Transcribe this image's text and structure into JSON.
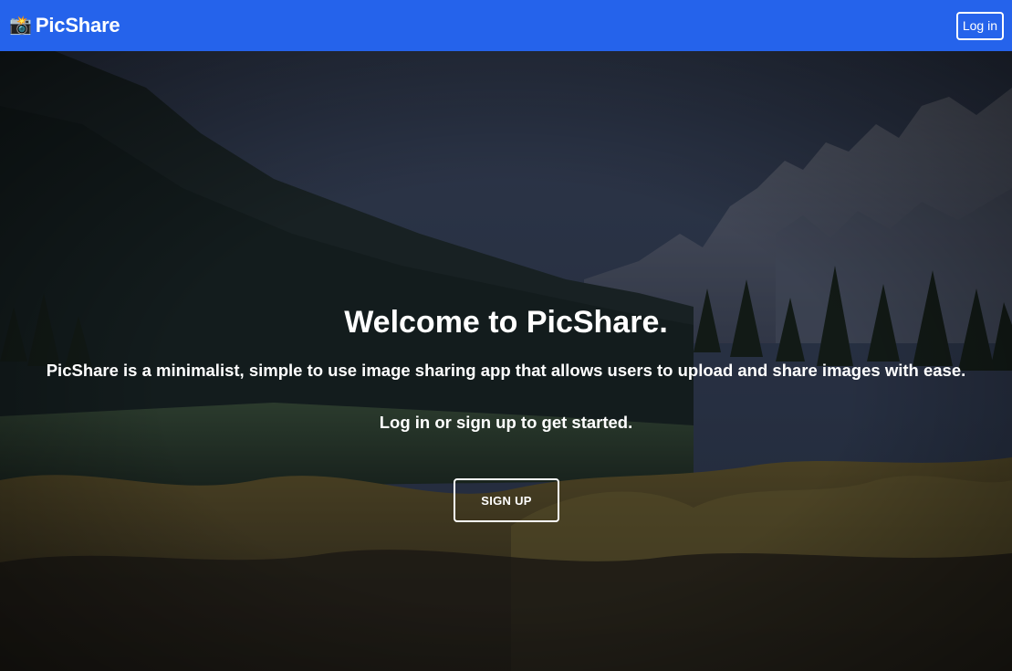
{
  "navbar": {
    "brand_icon": "📸",
    "brand_name": "PicShare",
    "login_label": "Log in",
    "background_color": "#2563eb"
  },
  "hero": {
    "title": "Welcome to PicShare.",
    "description": "PicShare is a minimalist, simple to use image sharing app that allows users to upload and share images with ease.",
    "cta_text": "Log in or sign up to get started.",
    "signup_label": "SIGN UP",
    "background_image": "dark-mountain-lake-landscape"
  }
}
